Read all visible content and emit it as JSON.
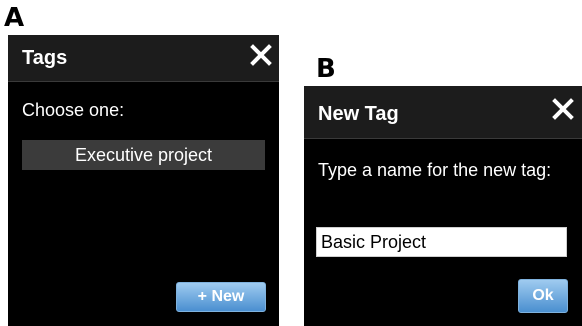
{
  "panel_labels": {
    "a": "A",
    "b": "B"
  },
  "dialog_tags": {
    "title": "Tags",
    "prompt": "Choose one:",
    "option": "Executive project",
    "new_button": "+ New"
  },
  "dialog_new_tag": {
    "title": "New Tag",
    "prompt": "Type a name for the new tag:",
    "input_value": "Basic Project",
    "ok_button": "Ok"
  },
  "icons": {
    "close": "close-icon"
  },
  "colors": {
    "dialog_bg": "#000000",
    "title_bar_bg": "#1c1c1c",
    "option_bg": "#3b3b3b",
    "button_gradient_top": "#9fcbf0",
    "button_gradient_bottom": "#4a8fd0"
  }
}
